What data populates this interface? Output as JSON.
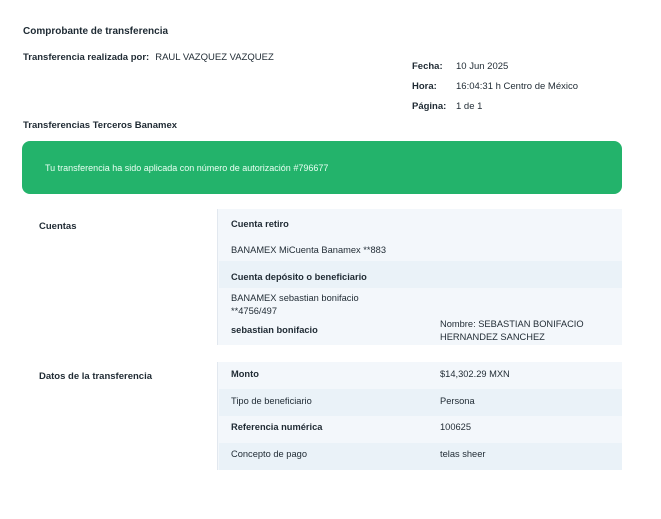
{
  "header": {
    "title": "Comprobante de transferencia",
    "done_by_label": "Transferencia realizada por:",
    "done_by_value": "RAUL VAZQUEZ VAZQUEZ",
    "meta": [
      {
        "label": "Fecha:",
        "value": "10 Jun 2025"
      },
      {
        "label": "Hora:",
        "value": "16:04:31 h Centro de México"
      },
      {
        "label": "Página:",
        "value": "1 de 1"
      }
    ]
  },
  "section_title": "Transferencias Terceros Banamex",
  "banner_text": "Tu transferencia ha sido aplicada con número de autorización #796677",
  "accounts": {
    "label": "Cuentas",
    "withdraw_label": "Cuenta retiro",
    "withdraw_value": "BANAMEX MiCuenta Banamex **883",
    "deposit_label": "Cuenta depósito o beneficiario",
    "deposit_value_line1": "BANAMEX sebastian bonifacio",
    "deposit_value_line2": "**4756/497",
    "beneficiary_alias": "sebastian bonifacio",
    "beneficiary_name_line1": "Nombre: SEBASTIAN BONIFACIO",
    "beneficiary_name_line2": "HERNANDEZ SANCHEZ"
  },
  "transfer": {
    "label": "Datos de la transferencia",
    "rows": [
      {
        "key": "Monto",
        "value": "$14,302.29 MXN",
        "bold": true
      },
      {
        "key": "Tipo de beneficiario",
        "value": "Persona",
        "bold": false
      },
      {
        "key": "Referencia numérica",
        "value": "100625",
        "bold": true
      },
      {
        "key": "Concepto de pago",
        "value": "telas sheer",
        "bold": false
      }
    ]
  }
}
